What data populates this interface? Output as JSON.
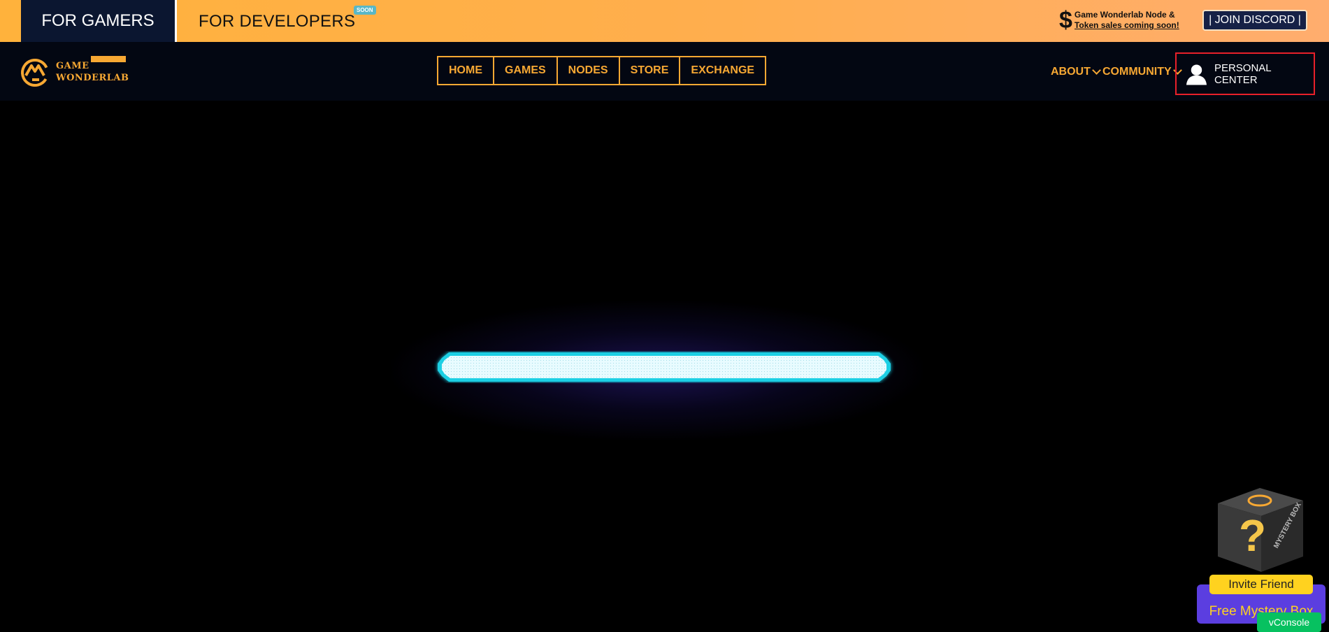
{
  "topbar": {
    "gamers_tab": "FOR GAMERS",
    "developers_tab": "FOR DEVELOPERS",
    "soon_badge": "SOON",
    "promo_line1": "Game Wonderlab Node &",
    "promo_line2": "Token sales coming soon!",
    "discord_button": "| JOIN DISCORD |"
  },
  "logo": {
    "line1": "GAME",
    "line2": "WONDERLAB"
  },
  "nav": {
    "items": [
      "HOME",
      "GAMES",
      "NODES",
      "STORE",
      "EXCHANGE"
    ],
    "about": "ABOUT",
    "community": "COMMUNITY",
    "personal_center": "PERSONAL CENTER"
  },
  "loading": {
    "progress_percent": 0
  },
  "mystery_box": {
    "box_label": "MYSTERY BOX",
    "invite_button": "Invite Friend",
    "free_button": "Free Mystery Box"
  },
  "vconsole": "vConsole",
  "colors": {
    "accent_orange": "#f7a833",
    "top_gradient_start": "#ffb23c",
    "top_gradient_end": "#ffad6e",
    "nav_bg": "#030712",
    "gamers_tab_bg": "#0b1630",
    "loading_cyan": "#19e0f2",
    "highlight_red": "#e8202a",
    "invite_yellow": "#ffd21f",
    "mystery_purple": "#5b3ee0",
    "vconsole_green": "#07c160"
  }
}
